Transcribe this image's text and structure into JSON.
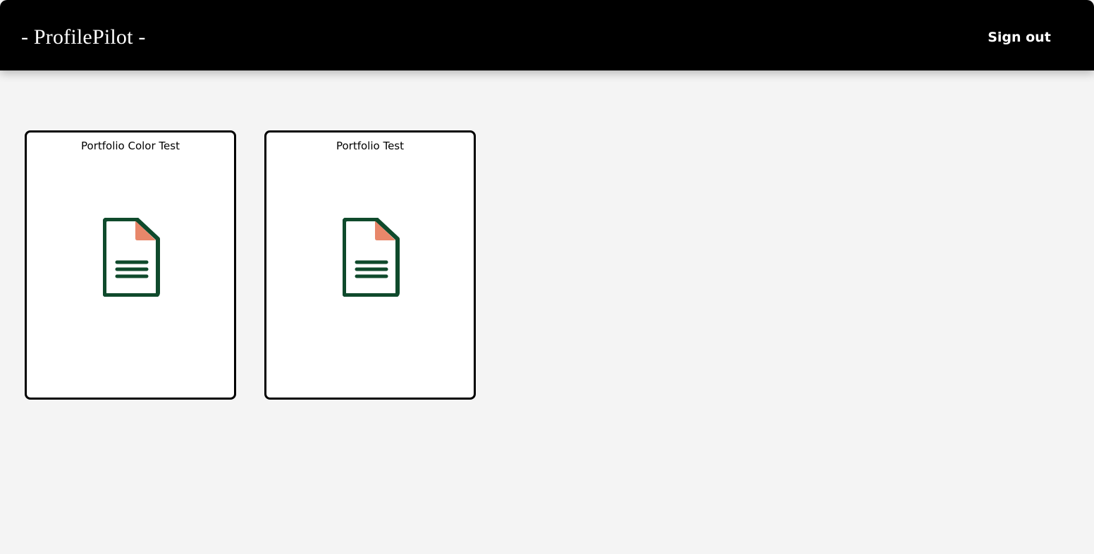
{
  "header": {
    "brand": "- ProfilePilot -",
    "sign_out_label": "Sign out"
  },
  "portfolios": [
    {
      "title": "Portfolio Color Test",
      "icon": "document-icon"
    },
    {
      "title": "Portfolio Test",
      "icon": "document-icon"
    }
  ],
  "colors": {
    "header_bg": "#000000",
    "page_bg": "#f4f4f4",
    "card_bg": "#ffffff",
    "card_border": "#000000",
    "icon_primary": "#0f4a2c",
    "icon_corner": "#e8876a"
  }
}
